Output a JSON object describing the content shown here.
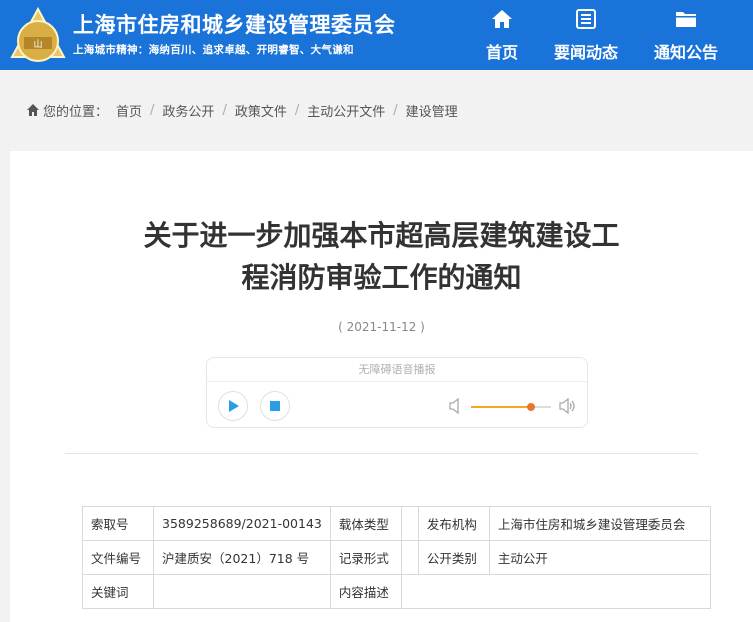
{
  "header": {
    "title": "上海市住房和城乡建设管理委员会",
    "slogan": "上海城市精神：海纳百川、追求卓越、开明睿智、大气谦和",
    "logo_icon": "shanghai-emblem-icon",
    "nav": [
      {
        "label": "首页",
        "icon": "home-icon"
      },
      {
        "label": "要闻动态",
        "icon": "news-icon"
      },
      {
        "label": "通知公告",
        "icon": "folder-icon"
      }
    ]
  },
  "breadcrumb": {
    "prefix": "您的位置：",
    "items": [
      "首页",
      "政务公开",
      "政策文件",
      "主动公开文件",
      "建设管理"
    ]
  },
  "article": {
    "title_line1": "关于进一步加强本市超高层建筑建设工",
    "title_line2": "程消防审验工作的通知",
    "date": "( 2021-11-12 )"
  },
  "player": {
    "label": "无障碍语音播报",
    "volume": 0.75,
    "accent_color": "#f5a623",
    "play_color": "#2a9ce8"
  },
  "meta": {
    "rows": [
      [
        "索取号",
        "3589258689/2021-00143",
        "载体类型",
        "",
        "发布机构",
        "上海市住房和城乡建设管理委员会"
      ],
      [
        "文件编号",
        "沪建质安（2021）718 号",
        "记录形式",
        "",
        "公开类别",
        "主动公开"
      ],
      [
        "关键词",
        "",
        "内容描述",
        "",
        "",
        ""
      ]
    ]
  },
  "colors": {
    "header_bg": "#1a73d9"
  }
}
